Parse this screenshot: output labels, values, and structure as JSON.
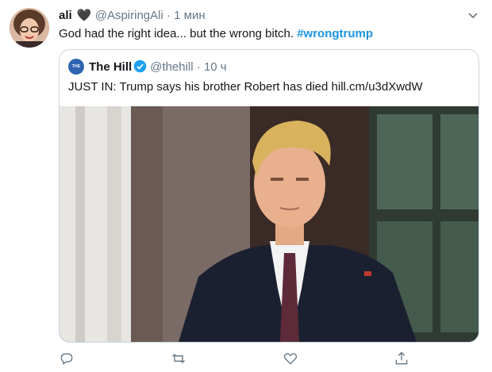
{
  "tweet": {
    "author_name": "ali",
    "author_heart": "🖤",
    "author_handle": "@AspiringAli",
    "separator": "·",
    "time": "1 мин",
    "text_prefix": "God had the right idea... but the wrong bitch.",
    "hashtag": "#wrongtrump"
  },
  "quoted": {
    "logo_text": "THE HILL",
    "author_name": "The Hill",
    "author_handle": "@thehill",
    "separator": "·",
    "time": "10 ч",
    "text": "JUST IN: Trump says his brother Robert has died hill.cm/u3dXwdW"
  },
  "actions": {
    "reply_icon": "reply-icon",
    "retweet_icon": "retweet-icon",
    "like_icon": "heart-icon",
    "share_icon": "share-icon"
  },
  "colors": {
    "link": "#1b95e0",
    "muted": "#657786",
    "border": "#ccd6dd",
    "verified": "#1da1f2"
  }
}
